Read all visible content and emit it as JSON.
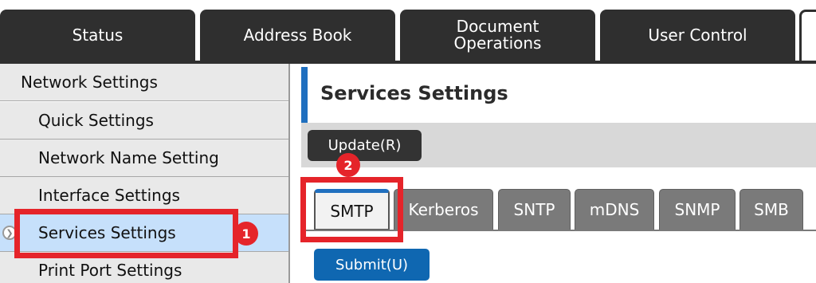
{
  "top_tabs": [
    {
      "label": "Status"
    },
    {
      "label": "Address Book"
    },
    {
      "label": "Document\nOperations"
    },
    {
      "label": "User Control"
    }
  ],
  "sidebar": {
    "section_title": "Network Settings",
    "items": [
      {
        "label": "Quick Settings"
      },
      {
        "label": "Network Name Setting"
      },
      {
        "label": "Interface Settings"
      },
      {
        "label": "Services Settings"
      },
      {
        "label": "Print Port Settings"
      }
    ],
    "selected": "Services Settings"
  },
  "main": {
    "title": "Services Settings",
    "update_button": "Update(R)",
    "tabs": [
      {
        "label": "SMTP"
      },
      {
        "label": "Kerberos"
      },
      {
        "label": "SNTP"
      },
      {
        "label": "mDNS"
      },
      {
        "label": "SNMP"
      },
      {
        "label": "SMB"
      }
    ],
    "active_tab": "SMTP",
    "submit_button": "Submit(U)"
  },
  "annotations": {
    "badge_1": "1",
    "badge_2": "2",
    "highlight_color": "#e5242a"
  },
  "colors": {
    "nav_dark": "#2f2f2f",
    "accent_blue": "#1f6fbf",
    "submit_blue": "#0f67b1",
    "selected_bg": "#c6e0fb"
  }
}
